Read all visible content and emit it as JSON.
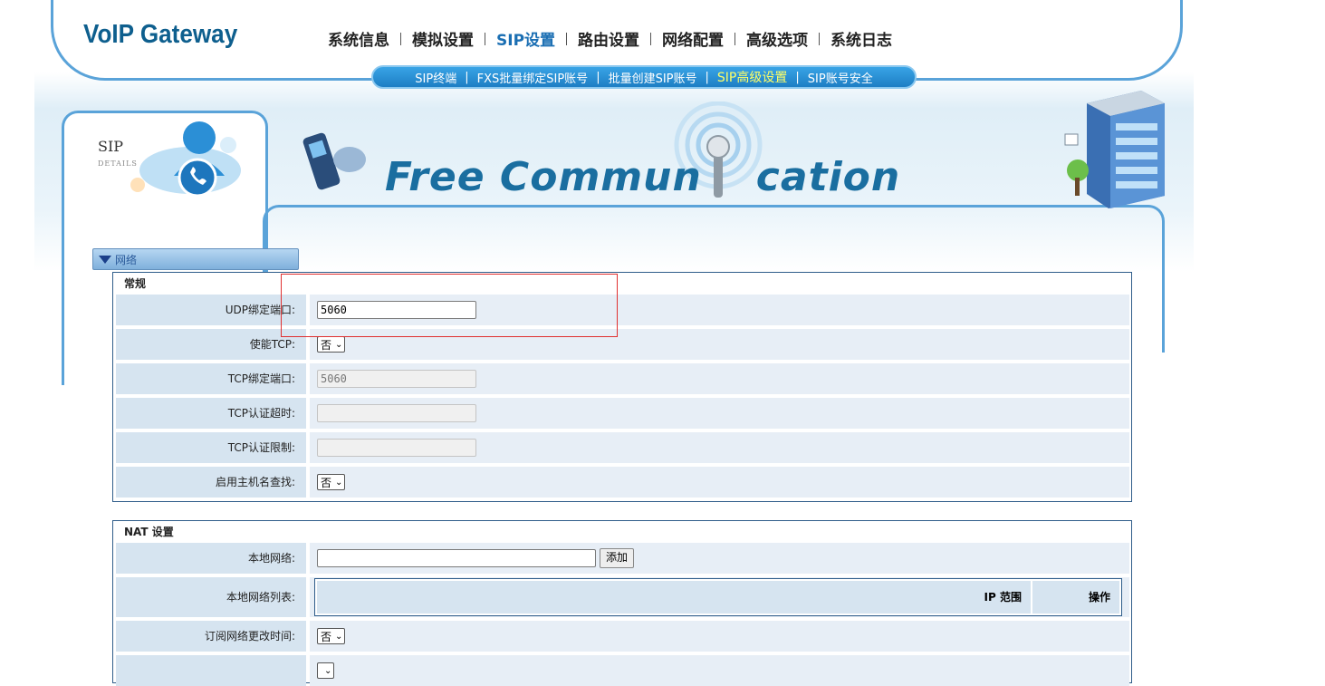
{
  "logo": "VoIP Gateway",
  "main_nav": [
    {
      "label": "系统信息",
      "active": false
    },
    {
      "label": "模拟设置",
      "active": false
    },
    {
      "label": "SIP设置",
      "active": true
    },
    {
      "label": "路由设置",
      "active": false
    },
    {
      "label": "网络配置",
      "active": false
    },
    {
      "label": "高级选项",
      "active": false
    },
    {
      "label": "系统日志",
      "active": false
    }
  ],
  "sub_nav": [
    {
      "label": "SIP终端",
      "active": false
    },
    {
      "label": "FXS批量绑定SIP账号",
      "active": false
    },
    {
      "label": "批量创建SIP账号",
      "active": false
    },
    {
      "label": "SIP高级设置",
      "active": true
    },
    {
      "label": "SIP账号安全",
      "active": false
    }
  ],
  "sidebar": {
    "title": "SIP",
    "subtitle": "DETAILS"
  },
  "banner": {
    "text": "Free Commun    cation"
  },
  "section": {
    "label": "网络"
  },
  "general": {
    "title": "常规",
    "udp_port_label": "UDP绑定端口:",
    "udp_port_value": "5060",
    "enable_tcp_label": "使能TCP:",
    "enable_tcp_value": "否",
    "tcp_port_label": "TCP绑定端口:",
    "tcp_port_value": "5060",
    "tcp_auth_timeout_label": "TCP认证超时:",
    "tcp_auth_timeout_value": "",
    "tcp_auth_limit_label": "TCP认证限制:",
    "tcp_auth_limit_value": "",
    "hostname_lookup_label": "启用主机名查找:",
    "hostname_lookup_value": "否"
  },
  "nat": {
    "title": "NAT 设置",
    "local_net_label": "本地网络:",
    "local_net_value": "",
    "add_button": "添加",
    "local_net_list_label": "本地网络列表:",
    "col_ip_range": "IP 范围",
    "col_action": "操作",
    "subscribe_change_label": "订阅网络更改时间:",
    "subscribe_change_value": "否"
  },
  "colors": {
    "accent": "#1b6fb3",
    "border": "#5aa3d9",
    "row_label": "#d6e4f0",
    "row_value": "#e7eef6"
  }
}
